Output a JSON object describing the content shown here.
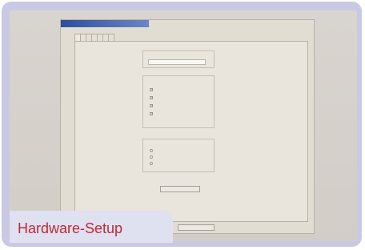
{
  "window": {
    "title": "",
    "tabs": [
      "",
      "",
      "",
      "",
      "",
      "",
      ""
    ]
  },
  "panel": {
    "port_group": {
      "label": "",
      "selected": ""
    },
    "channel_group": {
      "label": "",
      "items": [
        "",
        "",
        "",
        ""
      ]
    },
    "mode_group": {
      "label": "",
      "items": [
        "",
        "",
        ""
      ]
    },
    "detect_button": ""
  },
  "footer": {
    "button": "",
    "status": ""
  },
  "caption": "Hardware-Setup",
  "colors": {
    "caption_text": "#bf2a37",
    "frame": "#c9c9e3",
    "title_bar": "#2d4e9c"
  }
}
